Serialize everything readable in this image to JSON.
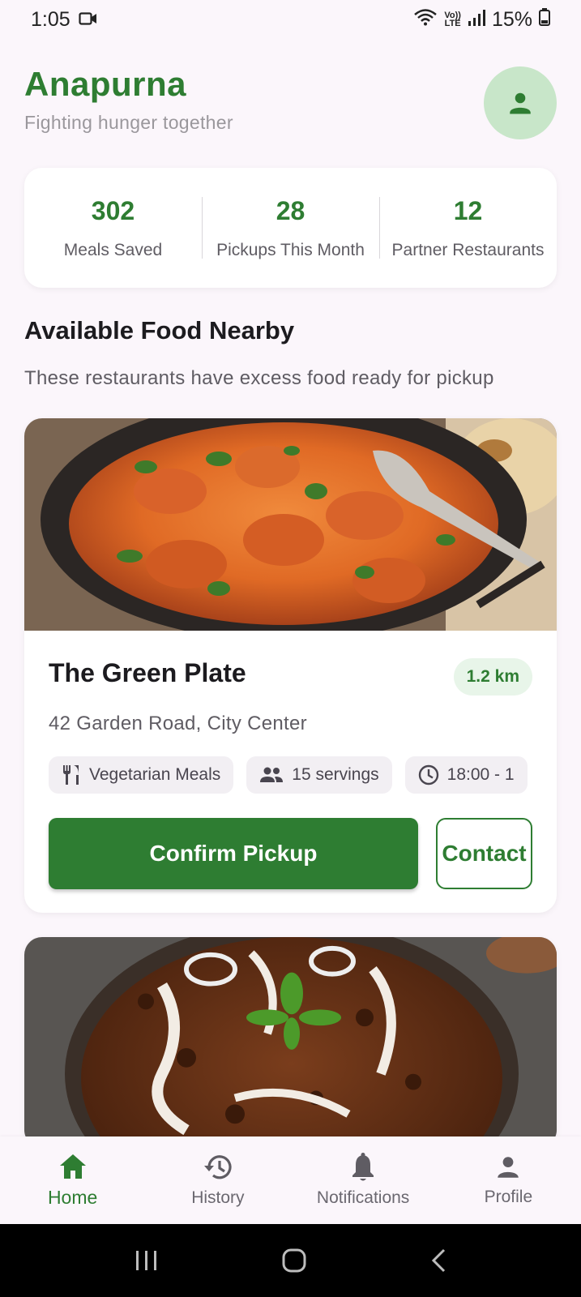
{
  "status_bar": {
    "time": "1:05",
    "battery": "15%",
    "lte_top": "Vo))",
    "lte_bottom": "LTE"
  },
  "header": {
    "title": "Anapurna",
    "subtitle": "Fighting hunger together",
    "avatar_icon": "person-icon"
  },
  "stats": [
    {
      "value": "302",
      "label": "Meals Saved"
    },
    {
      "value": "28",
      "label": "Pickups This Month"
    },
    {
      "value": "12",
      "label": "Partner Restaurants"
    }
  ],
  "section": {
    "title": "Available Food Nearby",
    "description": "These restaurants have excess food ready for pickup"
  },
  "listings": [
    {
      "name": "The Green Plate",
      "distance": "1.2 km",
      "address": "42 Garden Road, City Center",
      "chips": {
        "food_type": "Vegetarian Meals",
        "servings": "15 servings",
        "time": "18:00 - 1"
      },
      "confirm_label": "Confirm Pickup",
      "contact_label": "Contact"
    }
  ],
  "nav": [
    {
      "label": "Home",
      "icon": "home-icon",
      "active": true
    },
    {
      "label": "History",
      "icon": "history-icon",
      "active": false
    },
    {
      "label": "Notifications",
      "icon": "bell-icon",
      "active": false
    },
    {
      "label": "Profile",
      "icon": "person-icon",
      "active": false
    }
  ],
  "colors": {
    "primary": "#2e7d32",
    "primary_light": "#c8e6c9",
    "background": "#fbf6fb"
  }
}
